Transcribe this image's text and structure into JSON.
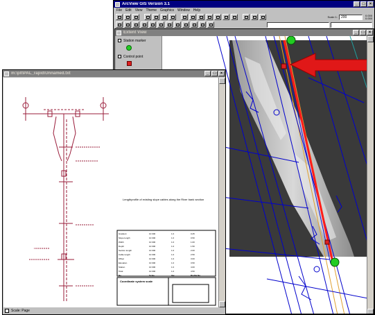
{
  "app": {
    "title": "ArcView GIS Version 3.1",
    "menus": [
      "File",
      "Edit",
      "View",
      "Theme",
      "Graphics",
      "Window",
      "Help"
    ],
    "scale_label": "Scale 1:",
    "scale_value": "200",
    "coord_x": "0.000",
    "coord_y": "0.000"
  },
  "view": {
    "title": "Extent View",
    "legend": [
      {
        "label": "Station marker",
        "symbol": "green-dot-icon",
        "color": "#22cc22"
      },
      {
        "label": "Control point",
        "symbol": "red-square-icon",
        "color": "#dd2020"
      }
    ]
  },
  "drawing": {
    "title": "m:\\plt\\PAL_rapid\\Unnamed.txt",
    "caption": "Lengthprofile of existing slope cables along the River bank section",
    "status_label": "Scale: Page",
    "title_block_header": "Coordinate system scale",
    "table_rows": [
      [
        "Gradient",
        "10 000",
        "1.0",
        "0.25"
      ],
      [
        "Slope length",
        "10 000",
        "1.0",
        "0.50"
      ],
      [
        "Width",
        "10 000",
        "1.0",
        "1.00"
      ],
      [
        "Depth",
        "10 000",
        "1.0",
        "1.50"
      ],
      [
        "Section length",
        "10 000",
        "1.0",
        "2.00"
      ],
      [
        "Cable length",
        "10 000",
        "1.0",
        "2.50"
      ],
      [
        "Offset",
        "10 000",
        "1.0",
        "3.00"
      ],
      [
        "Elevation",
        "10 000",
        "1.0",
        "3.50"
      ],
      [
        "Station",
        "10 000",
        "1.0",
        "4.00"
      ],
      [
        "Total",
        "10 000",
        "1.0",
        "4.50"
      ],
      [
        "No.",
        "Scale",
        "Ver.",
        "Profile No."
      ]
    ],
    "arrow_color": "#e01818"
  }
}
